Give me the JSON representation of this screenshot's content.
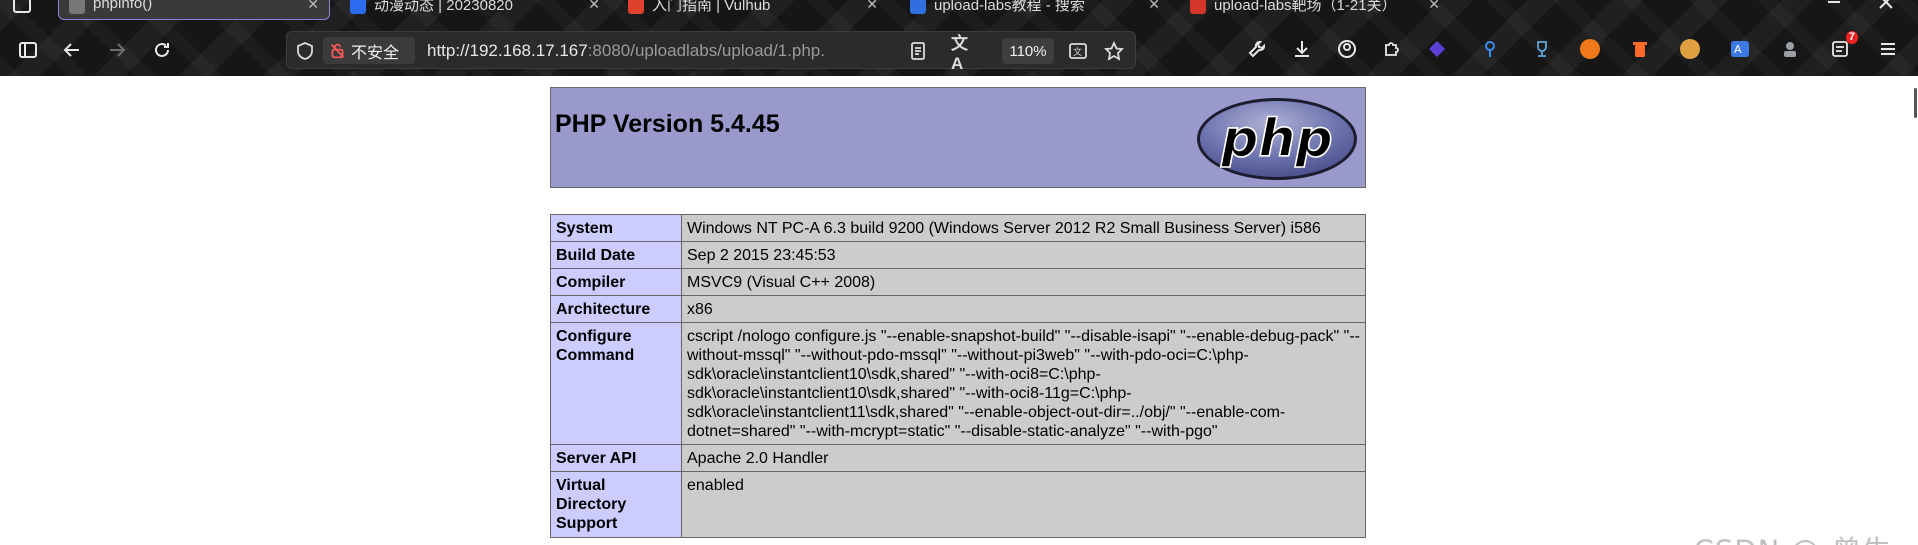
{
  "browser": {
    "tabs": [
      {
        "title": "phpinfo()",
        "active": true,
        "favicon_color": "#777777"
      },
      {
        "title": "动漫动态 | 20230820",
        "active": false,
        "favicon_color": "#2d6cf0"
      },
      {
        "title": "入门指南 | Vulhub",
        "active": false,
        "favicon_color": "#e0412d"
      },
      {
        "title": "upload-labs教程 - 搜索",
        "active": false,
        "favicon_color": "#2f6fe0"
      },
      {
        "title": "upload-labs靶场（1-21关）",
        "active": false,
        "favicon_color": "#d6352a"
      }
    ],
    "security_label": "不安全",
    "url_host": "http://192.168.17.167",
    "url_rest": ":8080/uploadlabs/upload/1.php.",
    "zoom": "110%",
    "notification_count": "7",
    "extensions": [
      {
        "name": "wrench-icon",
        "color": "#e8e8e8"
      },
      {
        "name": "download-icon",
        "color": "#e8e8e8"
      },
      {
        "name": "account-icon",
        "color": "#e8e8e8"
      },
      {
        "name": "puzzle-icon",
        "color": "#e8e8e8"
      },
      {
        "name": "purple-cube-ext",
        "color": "#5b3fd6"
      },
      {
        "name": "blue-pin-ext",
        "color": "#3a8ef0"
      },
      {
        "name": "trophy-ext",
        "color": "#5fa7d9"
      },
      {
        "name": "orange-ext",
        "color": "#f07a1a"
      },
      {
        "name": "trash-ext",
        "color": "#ff6a2a"
      },
      {
        "name": "cookie-ext",
        "color": "#e0a040"
      },
      {
        "name": "translate-ext",
        "color": "#3c7be6"
      },
      {
        "name": "agent-ext",
        "color": "#9aa0a6"
      },
      {
        "name": "notes-ext",
        "color": "#e8e8e8"
      }
    ]
  },
  "php": {
    "version_title": "PHP Version 5.4.45",
    "logo_text": "php",
    "rows": [
      {
        "key": "System",
        "value": "Windows NT PC-A 6.3 build 9200 (Windows Server 2012 R2 Small Business Server) i586"
      },
      {
        "key": "Build Date",
        "value": "Sep 2 2015 23:45:53"
      },
      {
        "key": "Compiler",
        "value": "MSVC9 (Visual C++ 2008)"
      },
      {
        "key": "Architecture",
        "value": "x86"
      },
      {
        "key": "Configure Command",
        "value": "cscript /nologo configure.js \"--enable-snapshot-build\" \"--disable-isapi\" \"--enable-debug-pack\" \"--without-mssql\" \"--without-pdo-mssql\" \"--without-pi3web\" \"--with-pdo-oci=C:\\php-sdk\\oracle\\instantclient10\\sdk,shared\" \"--with-oci8=C:\\php-sdk\\oracle\\instantclient10\\sdk,shared\" \"--with-oci8-11g=C:\\php-sdk\\oracle\\instantclient11\\sdk,shared\" \"--enable-object-out-dir=../obj/\" \"--enable-com-dotnet=shared\" \"--with-mcrypt=static\" \"--disable-static-analyze\" \"--with-pgo\""
      },
      {
        "key": "Server API",
        "value": "Apache 2.0 Handler"
      },
      {
        "key": "Virtual Directory Support",
        "value": "enabled"
      }
    ]
  },
  "watermark": "CSDN @-曾牛"
}
